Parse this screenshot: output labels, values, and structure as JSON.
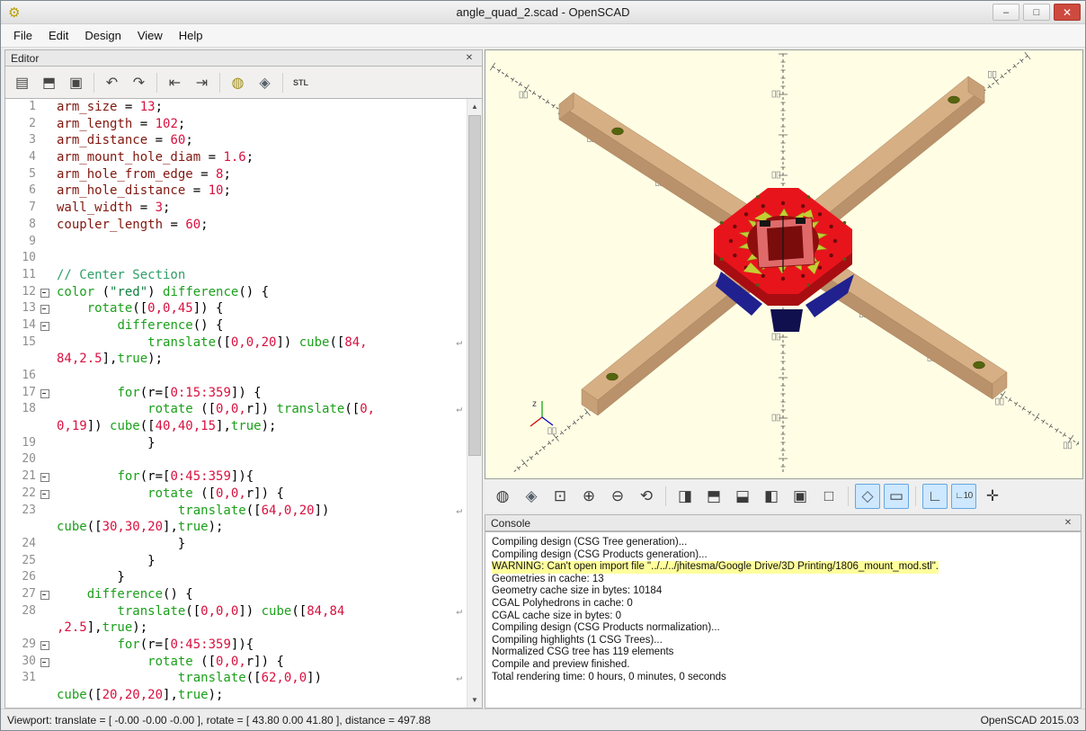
{
  "window": {
    "title": "angle_quad_2.scad - OpenSCAD",
    "controls": {
      "minimize": "–",
      "maximize": "□",
      "close": "✕"
    },
    "logo_glyph": "⚙"
  },
  "menu": [
    "File",
    "Edit",
    "Design",
    "View",
    "Help"
  ],
  "editor": {
    "title": "Editor",
    "close_glyph": "✕",
    "toolbar": [
      {
        "name": "new-file-icon",
        "glyph": "▤"
      },
      {
        "name": "open-file-icon",
        "glyph": "⬒"
      },
      {
        "name": "save-file-icon",
        "glyph": "▣"
      },
      {
        "name": "undo-icon",
        "glyph": "↶",
        "sep": true
      },
      {
        "name": "redo-icon",
        "glyph": "↷"
      },
      {
        "name": "unindent-icon",
        "glyph": "⇤",
        "sep": true
      },
      {
        "name": "indent-icon",
        "glyph": "⇥"
      },
      {
        "name": "preview-icon",
        "glyph": "◍",
        "sep": true
      },
      {
        "name": "render-icon",
        "glyph": "◈"
      },
      {
        "name": "export-stl-icon",
        "glyph": "STL",
        "sep": true
      }
    ],
    "scroll": {
      "up_glyph": "▲",
      "down_glyph": "▼"
    },
    "rows": [
      {
        "n": "1",
        "s": [
          [
            "v",
            "arm_size"
          ],
          [
            "p",
            " = "
          ],
          [
            "n",
            "13"
          ],
          [
            "p",
            ";"
          ]
        ]
      },
      {
        "n": "2",
        "s": [
          [
            "v",
            "arm_length"
          ],
          [
            "p",
            " = "
          ],
          [
            "n",
            "102"
          ],
          [
            "p",
            ";"
          ]
        ]
      },
      {
        "n": "3",
        "s": [
          [
            "v",
            "arm_distance"
          ],
          [
            "p",
            " = "
          ],
          [
            "n",
            "60"
          ],
          [
            "p",
            ";"
          ]
        ]
      },
      {
        "n": "4",
        "s": [
          [
            "v",
            "arm_mount_hole_diam"
          ],
          [
            "p",
            " = "
          ],
          [
            "n",
            "1.6"
          ],
          [
            "p",
            ";"
          ]
        ]
      },
      {
        "n": "5",
        "s": [
          [
            "v",
            "arm_hole_from_edge"
          ],
          [
            "p",
            " = "
          ],
          [
            "n",
            "8"
          ],
          [
            "p",
            ";"
          ]
        ]
      },
      {
        "n": "6",
        "s": [
          [
            "v",
            "arm_hole_distance"
          ],
          [
            "p",
            " = "
          ],
          [
            "n",
            "10"
          ],
          [
            "p",
            ";"
          ]
        ]
      },
      {
        "n": "7",
        "s": [
          [
            "v",
            "wall_width"
          ],
          [
            "p",
            " = "
          ],
          [
            "n",
            "3"
          ],
          [
            "p",
            ";"
          ]
        ]
      },
      {
        "n": "8",
        "s": [
          [
            "v",
            "coupler_length"
          ],
          [
            "p",
            " = "
          ],
          [
            "n",
            "60"
          ],
          [
            "p",
            ";"
          ]
        ]
      },
      {
        "n": "9",
        "s": []
      },
      {
        "n": "10",
        "s": []
      },
      {
        "n": "11",
        "s": [
          [
            "c",
            "// Center Section"
          ]
        ]
      },
      {
        "n": "12",
        "f": true,
        "s": [
          [
            "k",
            "color"
          ],
          [
            "p",
            " ("
          ],
          [
            "s",
            "\"red\""
          ],
          [
            "p",
            ") "
          ],
          [
            "k",
            "difference"
          ],
          [
            "p",
            "() {"
          ]
        ]
      },
      {
        "n": "13",
        "f": true,
        "s": [
          [
            "p",
            "    "
          ],
          [
            "k",
            "rotate"
          ],
          [
            "p",
            "(["
          ],
          [
            "n",
            "0,0,45"
          ],
          [
            "p",
            "]) {"
          ]
        ]
      },
      {
        "n": "14",
        "f": true,
        "s": [
          [
            "p",
            "        "
          ],
          [
            "k",
            "difference"
          ],
          [
            "p",
            "() {"
          ]
        ]
      },
      {
        "n": "15",
        "w": true,
        "s": [
          [
            "p",
            "            "
          ],
          [
            "k",
            "translate"
          ],
          [
            "p",
            "(["
          ],
          [
            "n",
            "0,0,20"
          ],
          [
            "p",
            "]) "
          ],
          [
            "k",
            "cube"
          ],
          [
            "p",
            "(["
          ],
          [
            "n",
            "84,"
          ]
        ]
      },
      {
        "s": [
          [
            "n",
            "84,2.5"
          ],
          [
            "p",
            "],"
          ],
          [
            "k",
            "true"
          ],
          [
            "p",
            ");"
          ]
        ]
      },
      {
        "n": "16",
        "s": []
      },
      {
        "n": "17",
        "f": true,
        "s": [
          [
            "p",
            "        "
          ],
          [
            "k",
            "for"
          ],
          [
            "p",
            "(r=["
          ],
          [
            "n",
            "0:15:359"
          ],
          [
            "p",
            "]) {"
          ]
        ]
      },
      {
        "n": "18",
        "w": true,
        "s": [
          [
            "p",
            "            "
          ],
          [
            "k",
            "rotate"
          ],
          [
            "p",
            " (["
          ],
          [
            "n",
            "0,0,"
          ],
          [
            "p",
            "r]) "
          ],
          [
            "k",
            "translate"
          ],
          [
            "p",
            "(["
          ],
          [
            "n",
            "0,"
          ]
        ]
      },
      {
        "s": [
          [
            "n",
            "0,19"
          ],
          [
            "p",
            "]) "
          ],
          [
            "k",
            "cube"
          ],
          [
            "p",
            "(["
          ],
          [
            "n",
            "40,40,15"
          ],
          [
            "p",
            "],"
          ],
          [
            "k",
            "true"
          ],
          [
            "p",
            ");"
          ]
        ]
      },
      {
        "n": "19",
        "s": [
          [
            "p",
            "            }"
          ]
        ]
      },
      {
        "n": "20",
        "s": []
      },
      {
        "n": "21",
        "f": true,
        "s": [
          [
            "p",
            "        "
          ],
          [
            "k",
            "for"
          ],
          [
            "p",
            "(r=["
          ],
          [
            "n",
            "0:45:359"
          ],
          [
            "p",
            "]){"
          ]
        ]
      },
      {
        "n": "22",
        "f": true,
        "s": [
          [
            "p",
            "            "
          ],
          [
            "k",
            "rotate"
          ],
          [
            "p",
            " (["
          ],
          [
            "n",
            "0,0,"
          ],
          [
            "p",
            "r]) {"
          ]
        ]
      },
      {
        "n": "23",
        "w": true,
        "s": [
          [
            "p",
            "                "
          ],
          [
            "k",
            "translate"
          ],
          [
            "p",
            "(["
          ],
          [
            "n",
            "64,0,20"
          ],
          [
            "p",
            "])"
          ]
        ]
      },
      {
        "s": [
          [
            "k",
            "cube"
          ],
          [
            "p",
            "(["
          ],
          [
            "n",
            "30,30,20"
          ],
          [
            "p",
            "],"
          ],
          [
            "k",
            "true"
          ],
          [
            "p",
            ");"
          ]
        ]
      },
      {
        "n": "24",
        "s": [
          [
            "p",
            "                }"
          ]
        ]
      },
      {
        "n": "25",
        "s": [
          [
            "p",
            "            }"
          ]
        ]
      },
      {
        "n": "26",
        "s": [
          [
            "p",
            "        }"
          ]
        ]
      },
      {
        "n": "27",
        "f": true,
        "s": [
          [
            "p",
            "    "
          ],
          [
            "k",
            "difference"
          ],
          [
            "p",
            "() {"
          ]
        ]
      },
      {
        "n": "28",
        "w": true,
        "s": [
          [
            "p",
            "        "
          ],
          [
            "k",
            "translate"
          ],
          [
            "p",
            "(["
          ],
          [
            "n",
            "0,0,0"
          ],
          [
            "p",
            "]) "
          ],
          [
            "k",
            "cube"
          ],
          [
            "p",
            "(["
          ],
          [
            "n",
            "84,84"
          ]
        ]
      },
      {
        "s": [
          [
            "n",
            ",2.5"
          ],
          [
            "p",
            "],"
          ],
          [
            "k",
            "true"
          ],
          [
            "p",
            ");"
          ]
        ]
      },
      {
        "n": "29",
        "f": true,
        "s": [
          [
            "p",
            "        "
          ],
          [
            "k",
            "for"
          ],
          [
            "p",
            "(r=["
          ],
          [
            "n",
            "0:45:359"
          ],
          [
            "p",
            "]){"
          ]
        ]
      },
      {
        "n": "30",
        "f": true,
        "s": [
          [
            "p",
            "            "
          ],
          [
            "k",
            "rotate"
          ],
          [
            "p",
            " (["
          ],
          [
            "n",
            "0,0,"
          ],
          [
            "p",
            "r]) {"
          ]
        ]
      },
      {
        "n": "31",
        "w": true,
        "s": [
          [
            "p",
            "                "
          ],
          [
            "k",
            "translate"
          ],
          [
            "p",
            "(["
          ],
          [
            "n",
            "62,0,0"
          ],
          [
            "p",
            "])"
          ]
        ]
      },
      {
        "s": [
          [
            "k",
            "cube"
          ],
          [
            "p",
            "(["
          ],
          [
            "n",
            "20,20,20"
          ],
          [
            "p",
            "],"
          ],
          [
            "k",
            "true"
          ],
          [
            "p",
            ");"
          ]
        ]
      }
    ]
  },
  "viewport": {
    "axis_indicator_label": "z",
    "toolbar": [
      {
        "name": "preview-icon",
        "glyph": "◍"
      },
      {
        "name": "render-icon",
        "glyph": "◈"
      },
      {
        "name": "zoom-all-icon",
        "glyph": "⊡"
      },
      {
        "name": "zoom-in-icon",
        "glyph": "⊕"
      },
      {
        "name": "zoom-out-icon",
        "glyph": "⊖"
      },
      {
        "name": "reset-view-icon",
        "glyph": "⟲"
      },
      {
        "name": "view-right-icon",
        "glyph": "◨",
        "sep": true
      },
      {
        "name": "view-top-icon",
        "glyph": "⬒"
      },
      {
        "name": "view-bottom-icon",
        "glyph": "⬓"
      },
      {
        "name": "view-left-icon",
        "glyph": "◧"
      },
      {
        "name": "view-front-icon",
        "glyph": "▣"
      },
      {
        "name": "view-back-icon",
        "glyph": "□"
      },
      {
        "name": "view-perspective-icon",
        "glyph": "◇",
        "sep": true,
        "active": true
      },
      {
        "name": "view-orthogonal-icon",
        "glyph": "▭",
        "active": true
      },
      {
        "name": "show-axes-icon",
        "glyph": "∟",
        "sep": true,
        "active": true
      },
      {
        "name": "show-scale-icon",
        "glyph": "∟10",
        "active": true
      },
      {
        "name": "show-crosshair-icon",
        "glyph": "✛"
      }
    ]
  },
  "console": {
    "title": "Console",
    "close_glyph": "✕",
    "lines": [
      {
        "text": "Compiling design (CSG Tree generation)...",
        "warn": false
      },
      {
        "text": "Compiling design (CSG Products generation)...",
        "warn": false
      },
      {
        "text": "WARNING: Can't open import file \"../../../jhitesma/Google Drive/3D Printing/1806_mount_mod.stl\".",
        "warn": true
      },
      {
        "text": "Geometries in cache: 13",
        "warn": false
      },
      {
        "text": "Geometry cache size in bytes: 10184",
        "warn": false
      },
      {
        "text": "CGAL Polyhedrons in cache: 0",
        "warn": false
      },
      {
        "text": "CGAL cache size in bytes: 0",
        "warn": false
      },
      {
        "text": "Compiling design (CSG Products normalization)...",
        "warn": false
      },
      {
        "text": "Compiling highlights (1 CSG Trees)...",
        "warn": false
      },
      {
        "text": "Normalized CSG tree has 119 elements",
        "warn": false
      },
      {
        "text": "Compile and preview finished.",
        "warn": false
      },
      {
        "text": "Total rendering time: 0 hours, 0 minutes, 0 seconds",
        "warn": false
      }
    ]
  },
  "statusbar": {
    "left": "Viewport: translate = [ -0.00 -0.00 -0.00 ], rotate = [ 43.80 0.00 41.80 ], distance = 497.88",
    "right": "OpenSCAD 2015.03"
  },
  "colors": {
    "viewport_bg": "#fffee5",
    "plate_red": "#e8141b",
    "arm_tan": "#d7af85",
    "warning_bg": "#ffff9c",
    "accent_active": "#cde8ff"
  }
}
